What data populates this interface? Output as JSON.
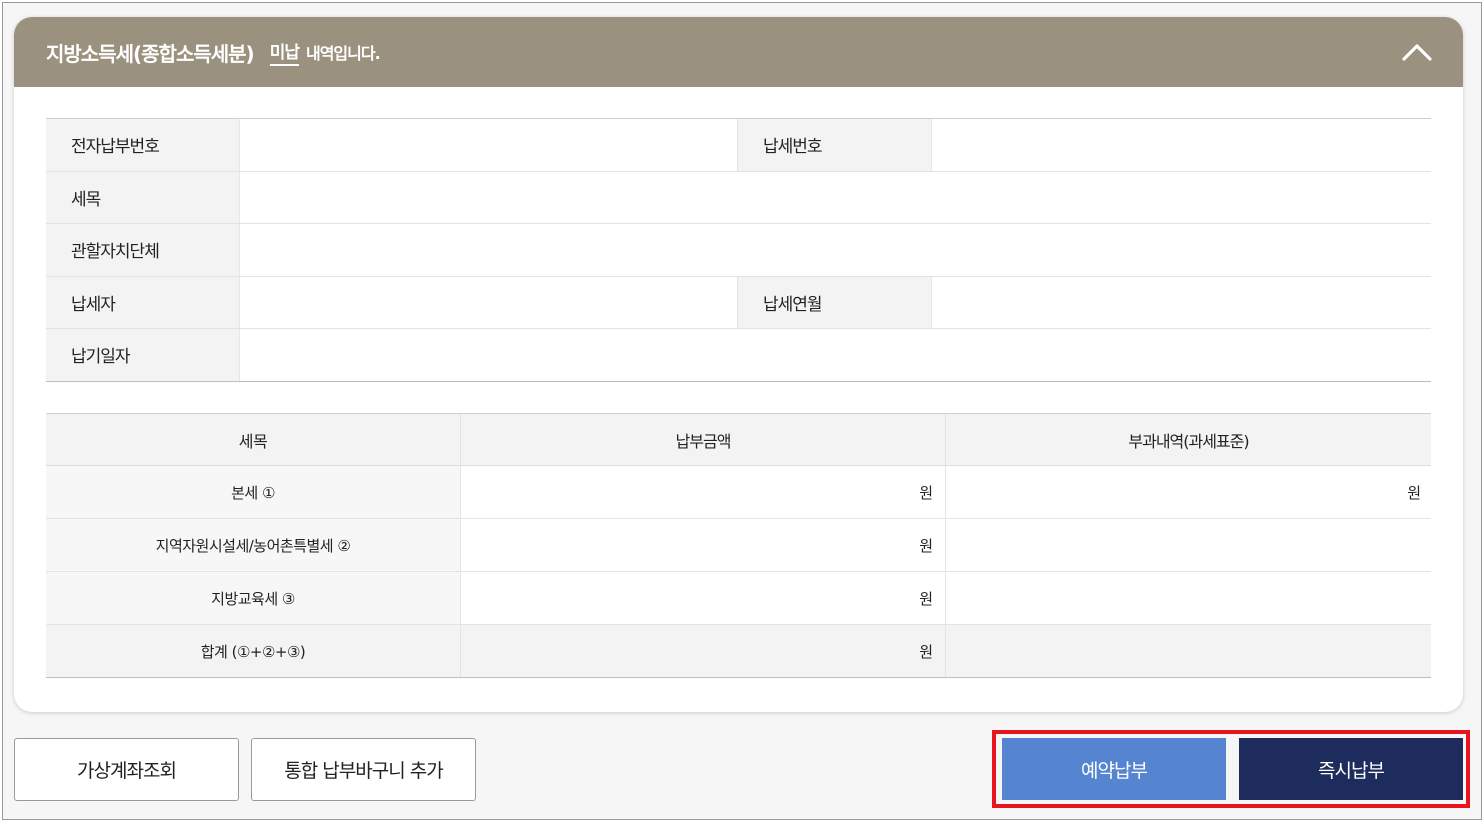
{
  "header": {
    "title": "지방소득세(종합소득세분)",
    "status": "미납",
    "description": "내역입니다."
  },
  "info": {
    "epay_number_label": "전자납부번호",
    "tax_number_label": "납세번호",
    "tax_item_label": "세목",
    "jurisdiction_label": "관할자치단체",
    "taxpayer_label": "납세자",
    "tax_month_label": "납세연월",
    "due_date_label": "납기일자"
  },
  "amount_table": {
    "headers": [
      "세목",
      "납부금액",
      "부과내역(과세표준)"
    ],
    "rows": [
      {
        "item": "본세 ①",
        "amount_unit": "원",
        "assess_unit": "원"
      },
      {
        "item": "지역자원시설세/농어촌특별세 ②",
        "amount_unit": "원",
        "assess_unit": ""
      },
      {
        "item": "지방교육세 ③",
        "amount_unit": "원",
        "assess_unit": ""
      },
      {
        "item": "합계 (①+②+③)",
        "amount_unit": "원",
        "assess_unit": ""
      }
    ]
  },
  "buttons": {
    "virtual_account": "가상계좌조회",
    "add_basket": "통합 납부바구니 추가",
    "reserve_pay": "예약납부",
    "pay_now": "즉시납부"
  },
  "colors": {
    "header_bg": "#9b917f",
    "reserve_btn": "#5584d0",
    "pay_now_btn": "#1d2c5c",
    "highlight": "#e8141e"
  }
}
